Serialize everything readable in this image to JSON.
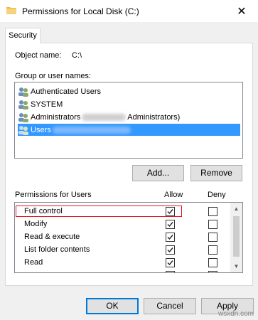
{
  "window": {
    "title": "Permissions for Local Disk (C:)",
    "close_glyph": "✕"
  },
  "tabs": [
    {
      "label": "Security"
    }
  ],
  "object": {
    "label": "Object name:",
    "value": "C:\\"
  },
  "groups": {
    "label": "Group or user names:",
    "items": [
      {
        "name": "Authenticated Users",
        "suffix": "",
        "selected": false
      },
      {
        "name": "SYSTEM",
        "suffix": "",
        "selected": false
      },
      {
        "name": "Administrators",
        "suffix": "Administrators)",
        "selected": false
      },
      {
        "name": "Users",
        "suffix": "",
        "selected": true
      }
    ]
  },
  "buttons": {
    "add": "Add...",
    "remove": "Remove",
    "ok": "OK",
    "cancel": "Cancel",
    "apply": "Apply"
  },
  "permissions": {
    "label": "Permissions for Users",
    "allow_header": "Allow",
    "deny_header": "Deny",
    "rows": [
      {
        "name": "Full control",
        "allow": true,
        "deny": false,
        "highlighted": true
      },
      {
        "name": "Modify",
        "allow": true,
        "deny": false
      },
      {
        "name": "Read & execute",
        "allow": true,
        "deny": false
      },
      {
        "name": "List folder contents",
        "allow": true,
        "deny": false
      },
      {
        "name": "Read",
        "allow": true,
        "deny": false
      },
      {
        "name": "",
        "allow": true,
        "deny": false
      }
    ]
  },
  "watermark": "wsxdn.com",
  "colors": {
    "selection": "#3399ff",
    "highlight_border": "#e81123",
    "accent": "#0078d7"
  }
}
